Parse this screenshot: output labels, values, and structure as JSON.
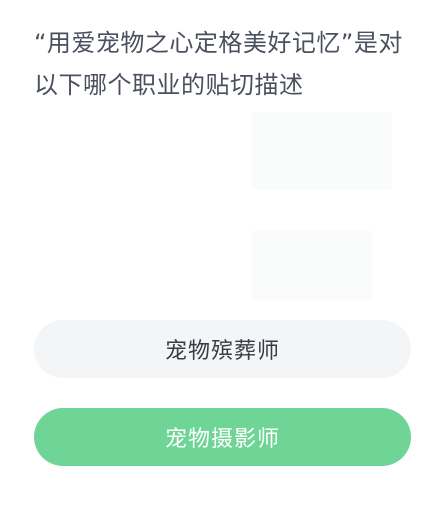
{
  "question": {
    "line1": "“用爱宠物之心定格美好记忆”是对",
    "line2": "以下哪个职业的贴切描述"
  },
  "options": [
    {
      "label": "宠物殡葬师",
      "state": "unselected",
      "color": "#f4f5f7"
    },
    {
      "label": "宠物摄影师",
      "state": "selected",
      "color": "#6fd597"
    }
  ]
}
